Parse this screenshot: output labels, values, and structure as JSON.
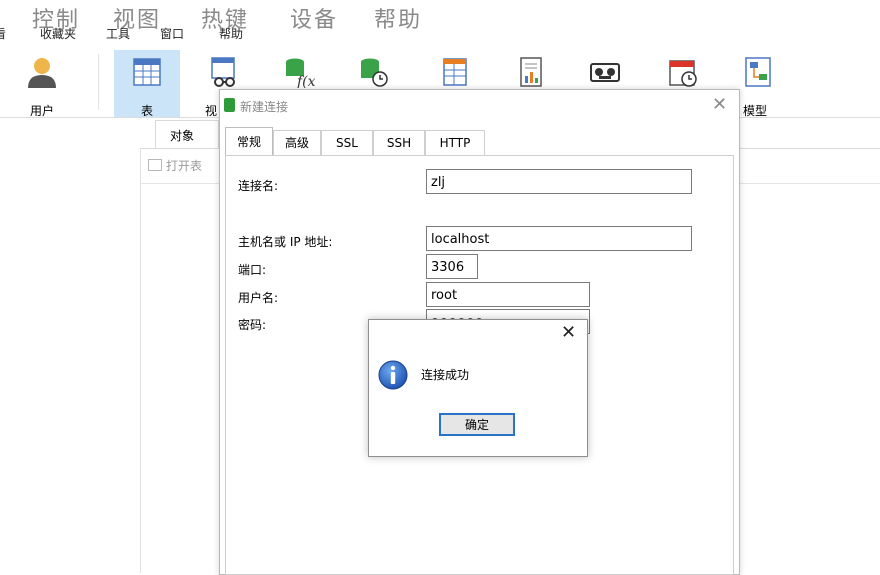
{
  "overlay_menu": [
    "控制",
    "视图",
    "热键",
    "设备",
    "帮助"
  ],
  "small_menu": [
    "看",
    "收藏夹",
    "工具",
    "窗口",
    "帮助"
  ],
  "toolbar": {
    "user": "用户",
    "table": "表",
    "view_partial": "视",
    "model": "模型"
  },
  "object_tab": "对象",
  "open_table": "打开表",
  "conn_dialog": {
    "title": "新建连接",
    "tabs": [
      "常规",
      "高级",
      "SSL",
      "SSH",
      "HTTP"
    ],
    "labels": {
      "conn_name": "连接名:",
      "host": "主机名或 IP 地址:",
      "port": "端口:",
      "user": "用户名:",
      "password": "密码:"
    },
    "values": {
      "conn_name": "zlj",
      "host": "localhost",
      "port": "3306",
      "user": "root",
      "password": "●●●●●●"
    }
  },
  "msgbox": {
    "text": "连接成功",
    "ok": "确定"
  }
}
